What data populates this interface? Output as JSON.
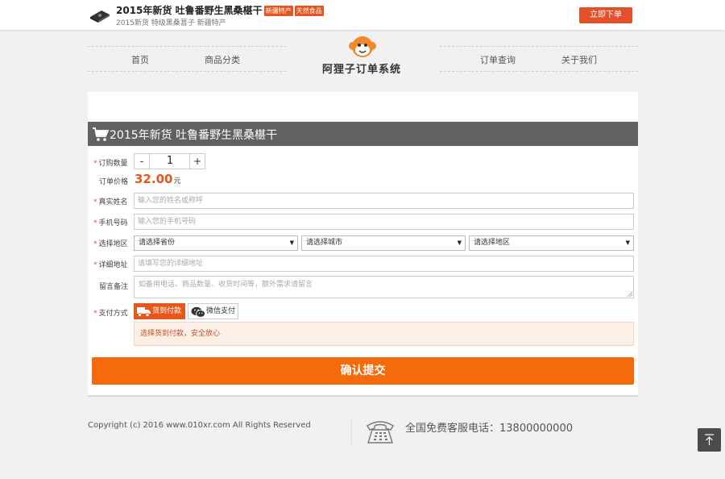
{
  "header": {
    "title": "2015年新货 吐鲁番野生黑桑椹干",
    "tags": [
      "新疆特产",
      "天然食品"
    ],
    "subtitle": "2015新货 特级黑桑葚子 新疆特产",
    "order_button": "立即下单"
  },
  "nav": {
    "left": [
      "首页",
      "商品分类"
    ],
    "right": [
      "订单查询",
      "关于我们"
    ],
    "logo_text": "阿狸子订单系统"
  },
  "form": {
    "title": "2015年新货 吐鲁番野生黑桑椹干",
    "quantity_label": "订购数量",
    "quantity_minus": "-",
    "quantity_value": "1",
    "quantity_plus": "+",
    "price_label": "订单价格",
    "price_value": "32.00",
    "price_unit": "元",
    "name_label": "真实姓名",
    "name_placeholder": "输入您的姓名或称呼",
    "phone_label": "手机号码",
    "phone_placeholder": "输入您的手机号码",
    "region_label": "选择地区",
    "province": "请选择省份",
    "city": "请选择城市",
    "district": "请选择地区",
    "address_label": "详细地址",
    "address_placeholder": "请填写您的详细地址",
    "remark_label": "留言备注",
    "remark_placeholder": "如备用电话、商品数量、收货时间等，额外需求请留言",
    "pay_label": "支付方式",
    "pay_cod": "货到付款",
    "pay_wechat": "微信支付",
    "notice": "选择货到付款，安全放心",
    "submit": "确认提交",
    "required_mark": "*"
  },
  "footer": {
    "copyright": "Copyright (c) 2016 www.010xr.com All Rights Reserved",
    "hotline": "全国免费客服电话：13800000000"
  },
  "colors": {
    "accent": "#e8561c",
    "submit": "#f56a0a",
    "panel_header": "#626060"
  },
  "icons": [
    "product-thumb-icon",
    "monkey-logo-icon",
    "cart-icon",
    "truck-icon",
    "wechat-icon",
    "phone-icon",
    "back-to-top-icon"
  ]
}
